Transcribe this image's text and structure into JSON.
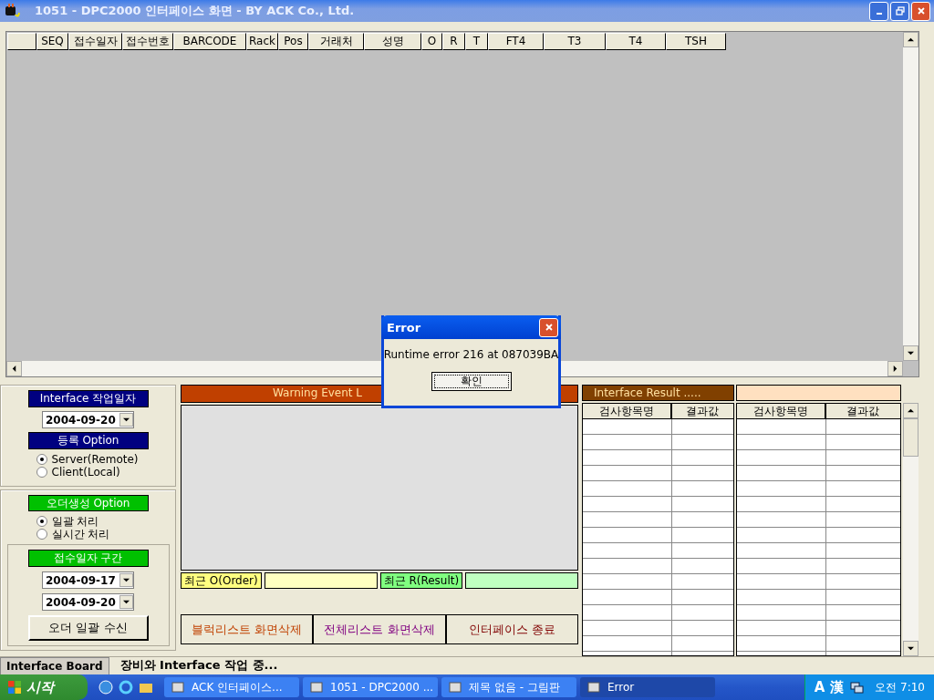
{
  "window": {
    "title": "1051 - DPC2000 인터페이스 화면 - BY ACK Co., Ltd."
  },
  "grid": {
    "columns": [
      "",
      "SEQ",
      "접수일자",
      "접수번호",
      "BARCODE",
      "Rack",
      "Pos",
      "거래처",
      "성명",
      "O",
      "R",
      "T",
      "FT4",
      "T3",
      "T4",
      "TSH"
    ]
  },
  "left_panel": {
    "work_date": {
      "label": "Interface 작업일자",
      "value": "2004-09-20"
    },
    "register_option": {
      "label": "등록 Option",
      "options": [
        {
          "label": "Server(Remote)",
          "selected": true
        },
        {
          "label": "Client(Local)",
          "selected": false
        }
      ]
    },
    "order_option": {
      "label": "오더생성 Option",
      "options": [
        {
          "label": "일괄 처리",
          "selected": true
        },
        {
          "label": "실시간 처리",
          "selected": false
        }
      ]
    },
    "date_range": {
      "label": "접수일자 구간",
      "from": "2004-09-17",
      "to": "2004-09-20"
    },
    "receive_button": "오더 일괄 수신"
  },
  "warning_log": {
    "title": "Warning Event L"
  },
  "recent": [
    {
      "label": "최근 O(Order)",
      "color": "#ffff80"
    },
    {
      "label": "최근 R(Result)",
      "color": "#80ff80"
    }
  ],
  "actions": [
    {
      "label": "블럭리스트 화면삭제",
      "color": "#c04000"
    },
    {
      "label": "전체리스트 화면삭제",
      "color": "#800080"
    },
    {
      "label": "인터페이스 종료",
      "color": "#800000"
    }
  ],
  "results": [
    {
      "title": "Interface Result .....",
      "color": "#804000",
      "columns": [
        "검사항목명",
        "결과값"
      ]
    },
    {
      "color": "#ffe0c0",
      "columns": [
        "검사항목명",
        "결과값"
      ]
    }
  ],
  "status_bar": {
    "tab": "Interface Board",
    "message": "장비와 Interface 작업 중..."
  },
  "dialog": {
    "title": "Error",
    "message": "Runtime error 216 at 087039BA",
    "button": "확인"
  },
  "taskbar": {
    "start": "시작",
    "tasks": [
      {
        "label": "ACK 인터페이스...",
        "selected": false
      },
      {
        "label": "1051 - DPC2000 ...",
        "selected": false
      },
      {
        "label": "제목 없음 - 그림판",
        "selected": false
      },
      {
        "label": "Error",
        "selected": true
      }
    ],
    "tray": [
      "A",
      "漢"
    ],
    "clock": "오전 7:10"
  }
}
